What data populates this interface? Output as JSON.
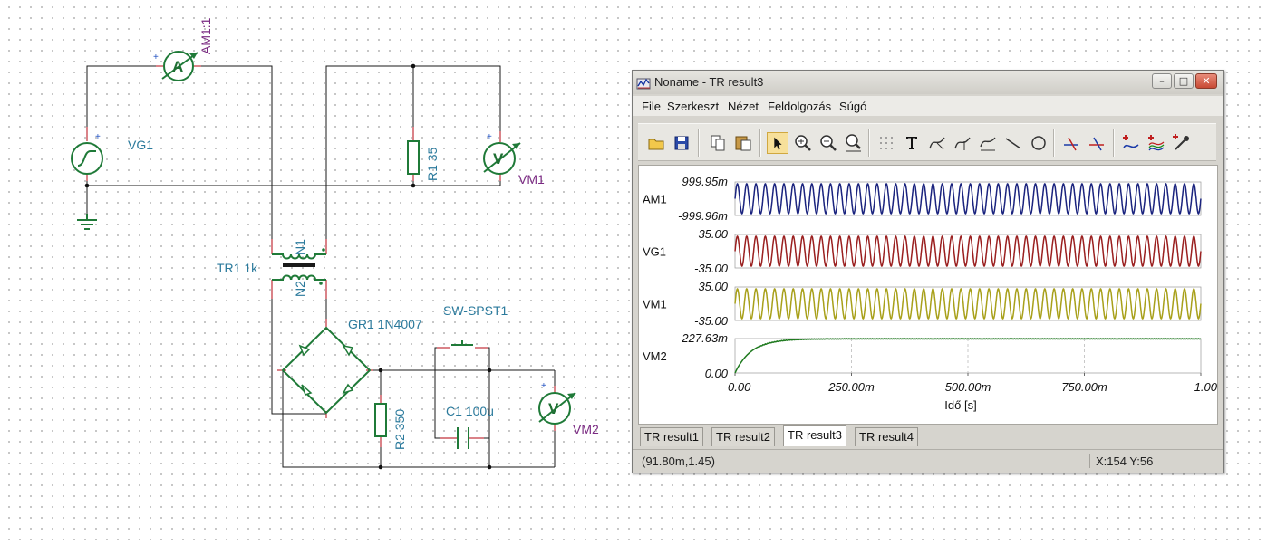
{
  "schematic": {
    "labels": {
      "am": "AM1:1",
      "vg": "VG1",
      "r1": "R1 35",
      "vm1": "VM1",
      "tr": "TR1 1k",
      "n1": "N1",
      "n2": "N2",
      "gr": "GR1 1N4007",
      "sw": "SW-SPST1",
      "r2": "R2 350",
      "c1": "C1 100u",
      "vm2": "VM2"
    },
    "glyphs": {
      "ammeter": "A",
      "voltmeter": "V",
      "plus": "+"
    }
  },
  "window": {
    "title": "Noname - TR result3",
    "menu": [
      "File",
      "Szerkeszt",
      "Nézet",
      "Feldolgozás",
      "Súgó"
    ],
    "toolbar_icons": [
      "open-folder-icon",
      "save-icon",
      "copy-icon",
      "paste-icon",
      "pointer-icon",
      "zoom-in-icon",
      "zoom-out-icon",
      "zoom-100-icon",
      "grid-icon",
      "text-icon",
      "curve-label-a-icon",
      "curve-label-b-icon",
      "curve-label-c-icon",
      "line-icon",
      "circle-icon",
      "cursor-a-icon",
      "cursor-b-icon",
      "add-curve-icon",
      "add-multi-curve-icon",
      "eyedropper-icon"
    ],
    "tabs": [
      "TR result1",
      "TR result2",
      "TR result3",
      "TR result4"
    ],
    "active_tab": 2,
    "status_coord": "(91.80m,1.45)",
    "status_xy": "X:154  Y:56"
  },
  "chart_data": {
    "type": "line",
    "xlabel": "Idő [s]",
    "xlim": [
      0,
      1
    ],
    "x_ticks": [
      "0.00",
      "250.00m",
      "500.00m",
      "750.00m",
      "1.00"
    ],
    "cycles": 50,
    "series": [
      {
        "name": "AM1",
        "kind": "sine",
        "ymax_label": "999.95m",
        "ymin_label": "-999.96m",
        "amplitude": 0.99995,
        "color": "#1a237e"
      },
      {
        "name": "VG1",
        "kind": "sine",
        "ymax_label": "35.00",
        "ymin_label": "-35.00",
        "amplitude": 35,
        "color": "#9a1f1f"
      },
      {
        "name": "VM1",
        "kind": "sine",
        "ymax_label": "35.00",
        "ymin_label": "-35.00",
        "amplitude": 35,
        "color": "#a8a01a"
      },
      {
        "name": "VM2",
        "kind": "charge",
        "ymax_label": "227.63m",
        "ymin_label": "0.00",
        "final": 0.22763,
        "tau": 0.035,
        "color": "#1f7a1f"
      }
    ]
  }
}
